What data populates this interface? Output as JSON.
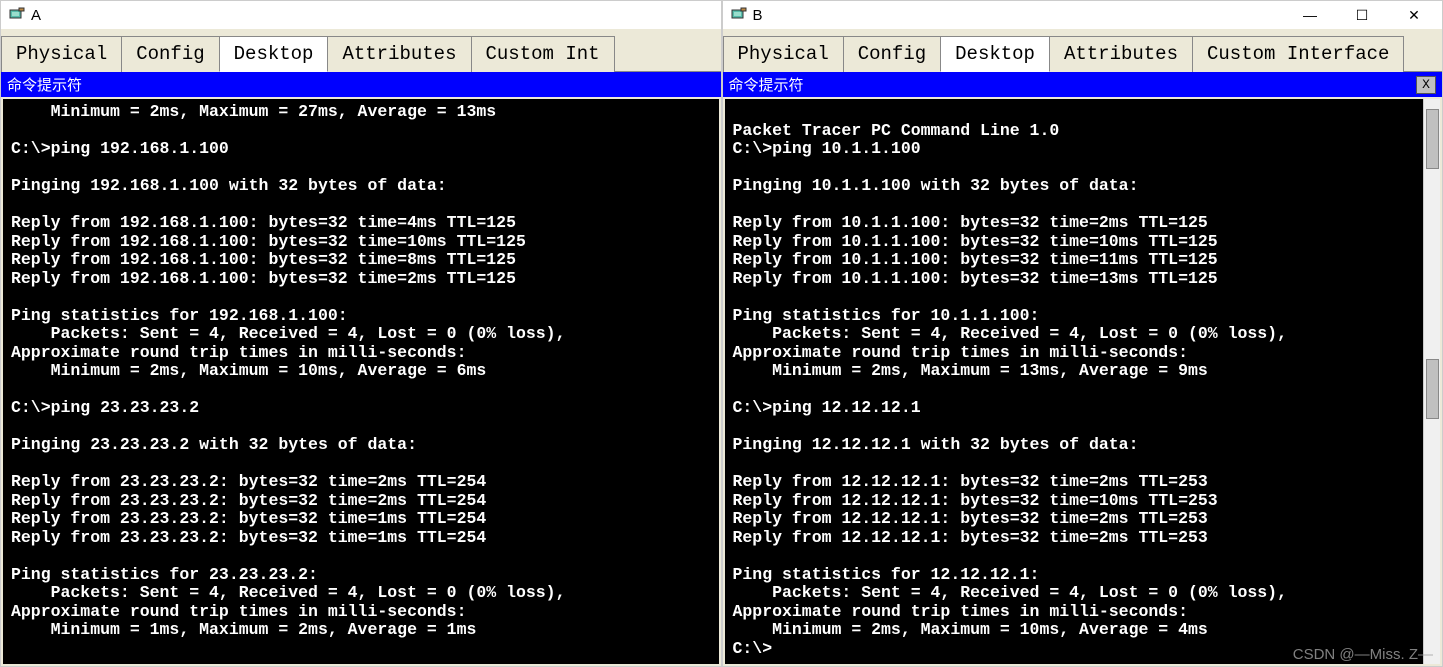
{
  "windowA": {
    "title": "A",
    "tabs": [
      "Physical",
      "Config",
      "Desktop",
      "Attributes",
      "Custom Int"
    ],
    "activeTab": 2,
    "promptTitle": "命令提示符",
    "terminal": "    Minimum = 2ms, Maximum = 27ms, Average = 13ms\n\nC:\\>ping 192.168.1.100\n\nPinging 192.168.1.100 with 32 bytes of data:\n\nReply from 192.168.1.100: bytes=32 time=4ms TTL=125\nReply from 192.168.1.100: bytes=32 time=10ms TTL=125\nReply from 192.168.1.100: bytes=32 time=8ms TTL=125\nReply from 192.168.1.100: bytes=32 time=2ms TTL=125\n\nPing statistics for 192.168.1.100:\n    Packets: Sent = 4, Received = 4, Lost = 0 (0% loss),\nApproximate round trip times in milli-seconds:\n    Minimum = 2ms, Maximum = 10ms, Average = 6ms\n\nC:\\>ping 23.23.23.2\n\nPinging 23.23.23.2 with 32 bytes of data:\n\nReply from 23.23.23.2: bytes=32 time=2ms TTL=254\nReply from 23.23.23.2: bytes=32 time=2ms TTL=254\nReply from 23.23.23.2: bytes=32 time=1ms TTL=254\nReply from 23.23.23.2: bytes=32 time=1ms TTL=254\n\nPing statistics for 23.23.23.2:\n    Packets: Sent = 4, Received = 4, Lost = 0 (0% loss),\nApproximate round trip times in milli-seconds:\n    Minimum = 1ms, Maximum = 2ms, Average = 1ms"
  },
  "windowB": {
    "title": "B",
    "tabs": [
      "Physical",
      "Config",
      "Desktop",
      "Attributes",
      "Custom Interface"
    ],
    "activeTab": 2,
    "promptTitle": "命令提示符",
    "closeLabel": "X",
    "terminal": "\nPacket Tracer PC Command Line 1.0\nC:\\>ping 10.1.1.100\n\nPinging 10.1.1.100 with 32 bytes of data:\n\nReply from 10.1.1.100: bytes=32 time=2ms TTL=125\nReply from 10.1.1.100: bytes=32 time=10ms TTL=125\nReply from 10.1.1.100: bytes=32 time=11ms TTL=125\nReply from 10.1.1.100: bytes=32 time=13ms TTL=125\n\nPing statistics for 10.1.1.100:\n    Packets: Sent = 4, Received = 4, Lost = 0 (0% loss),\nApproximate round trip times in milli-seconds:\n    Minimum = 2ms, Maximum = 13ms, Average = 9ms\n\nC:\\>ping 12.12.12.1\n\nPinging 12.12.12.1 with 32 bytes of data:\n\nReply from 12.12.12.1: bytes=32 time=2ms TTL=253\nReply from 12.12.12.1: bytes=32 time=10ms TTL=253\nReply from 12.12.12.1: bytes=32 time=2ms TTL=253\nReply from 12.12.12.1: bytes=32 time=2ms TTL=253\n\nPing statistics for 12.12.12.1:\n    Packets: Sent = 4, Received = 4, Lost = 0 (0% loss),\nApproximate round trip times in milli-seconds:\n    Minimum = 2ms, Maximum = 10ms, Average = 4ms\nC:\\>"
  },
  "watermark": "CSDN @—Miss. Z—"
}
